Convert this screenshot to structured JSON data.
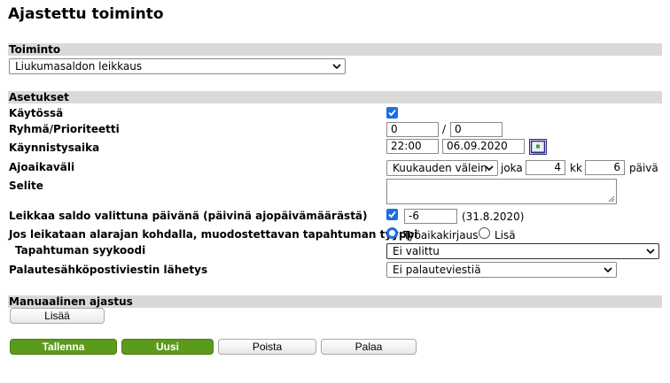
{
  "page": {
    "title": "Ajastettu toiminto"
  },
  "toiminto": {
    "header": "Toiminto",
    "selected": "Liukumasaldon leikkaus"
  },
  "asetukset": {
    "header": "Asetukset",
    "kaytossa_label": "Käytössä",
    "kaytossa_checked": true,
    "ryhma_label": "Ryhmä/Prioriteetti",
    "ryhma_value": "0",
    "slash": "/",
    "prioriteetti_value": "0",
    "kaynnistysaika_label": "Käynnistysaika",
    "time_value": "22:00",
    "date_value": "06.09.2020",
    "ajoaikavali_label": "Ajoaikaväli",
    "interval_selected": "Kuukauden välein",
    "joka_label": "joka",
    "joka_value": "4",
    "kk_label": "kk",
    "paiva_value": "6",
    "paiva_label": "päivä",
    "selite_label": "Selite",
    "selite_value": "",
    "leikkaa_label": "Leikkaa saldo valittuna päivänä (päivinä ajopäivämäärästä)",
    "leikkaa_checked": true,
    "leikkaa_value": "-6",
    "leikkaa_date": "(31.8.2020)",
    "tyyppi_label": "Jos leikataan alarajan kohdalla, muodostettavan tapahtuman tyyppi",
    "radio_option1": "Työaikakirjaus",
    "radio_option2": "Lisä",
    "radio_selected": "Työaikakirjaus",
    "syykoodi_label": "Tapahtuman syykoodi",
    "syykoodi_selected": "Ei valittu",
    "palaute_label": "Palautesähköpostiviestin lähetys",
    "palaute_selected": "Ei palauteviestiä"
  },
  "manuaalinen": {
    "header": "Manuaalinen ajastus",
    "lisaa_button": "Lisää"
  },
  "footer": {
    "tallenna": "Tallenna",
    "uusi": "Uusi",
    "poista": "Poista",
    "palaa": "Palaa"
  },
  "colors": {
    "accent_blue": "#1a6fe0",
    "button_green": "#5c9a1c",
    "section_grey": "#d9d9d9"
  }
}
